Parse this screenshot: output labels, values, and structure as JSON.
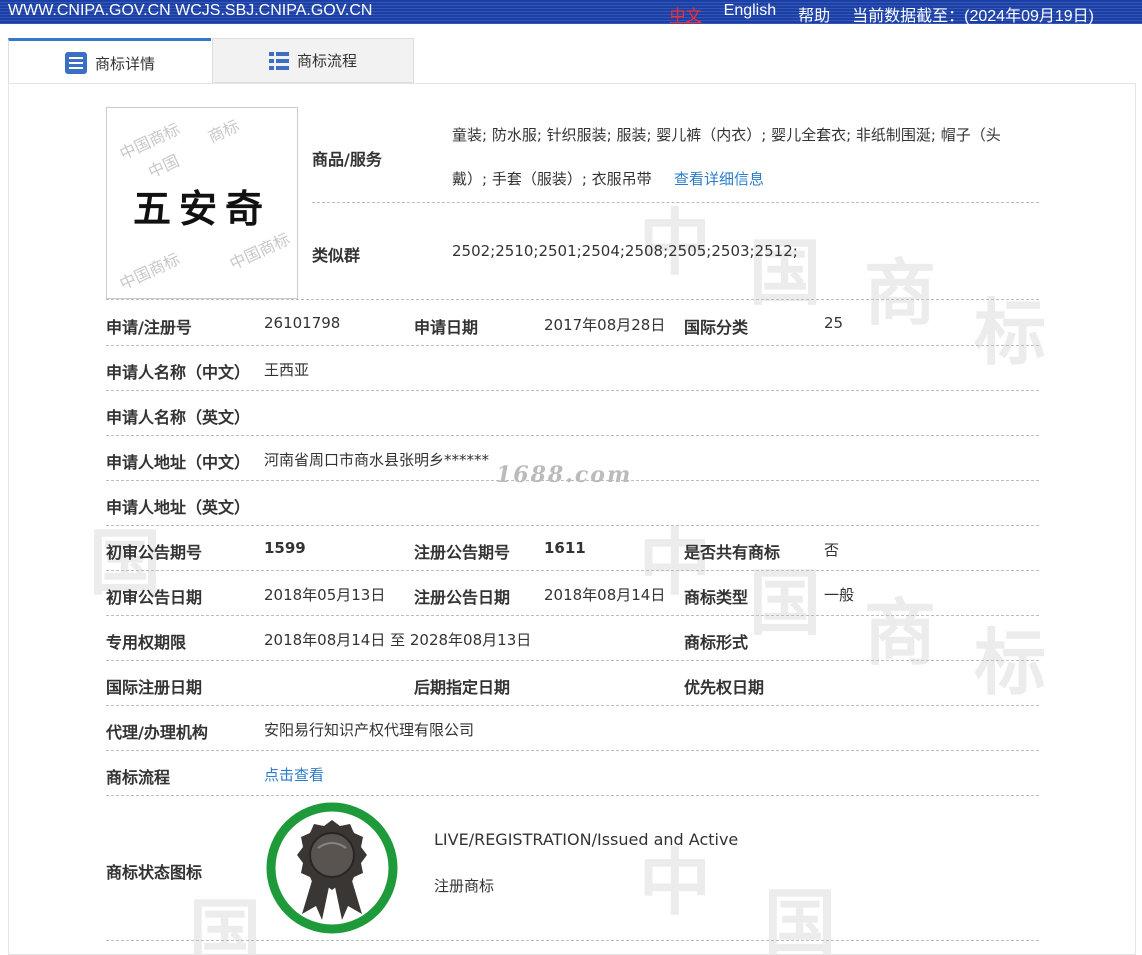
{
  "topbar": {
    "domains": "WWW.CNIPA.GOV.CN WCJS.SBJ.CNIPA.GOV.CN",
    "lang_zh": "中文",
    "lang_en": "English",
    "help": "帮助",
    "data_date": "当前数据截至：(2024年09月19日)"
  },
  "tabs": [
    {
      "label": "商标详情",
      "active": true
    },
    {
      "label": "商标流程",
      "active": false
    }
  ],
  "mark": {
    "logo_text": "五安奇",
    "goods_label": "商品/服务",
    "goods_value": "童装; 防水服; 针织服装; 服装; 婴儿裤（内衣）; 婴儿全套衣; 非纸制围涎; 帽子（头",
    "goods_value_2": "戴）; 手套（服装）; 衣服吊带",
    "goods_link": "查看详细信息",
    "similar_label": "类似群",
    "similar_value": "2502;2510;2501;2504;2508;2505;2503;2512;"
  },
  "fields": {
    "reg_no_label": "申请/注册号",
    "reg_no": "26101798",
    "apply_date_label": "申请日期",
    "apply_date": "2017年08月28日",
    "intl_class_label": "国际分类",
    "intl_class": "25",
    "applicant_cn_label": "申请人名称（中文）",
    "applicant_cn": "王西亚",
    "applicant_en_label": "申请人名称（英文）",
    "address_cn_label": "申请人地址（中文）",
    "address_cn": "河南省周口市商水县张明乡******",
    "address_en_label": "申请人地址（英文）",
    "prelim_no_label": "初审公告期号",
    "prelim_no": "1599",
    "reg_notice_no_label": "注册公告期号",
    "reg_notice_no": "1611",
    "shared_label": "是否共有商标",
    "shared": "否",
    "prelim_date_label": "初审公告日期",
    "prelim_date": "2018年05月13日",
    "reg_notice_date_label": "注册公告日期",
    "reg_notice_date": "2018年08月14日",
    "mark_type_label": "商标类型",
    "mark_type": "一般",
    "exclusive_label": "专用权期限",
    "exclusive": "2018年08月14日 至 2028年08月13日",
    "mark_form_label": "商标形式",
    "intl_reg_date_label": "国际注册日期",
    "later_date_label": "后期指定日期",
    "priority_label": "优先权日期",
    "agent_label": "代理/办理机构",
    "agent": "安阳易行知识产权代理有限公司",
    "flow_label": "商标流程",
    "flow_link": "点击查看",
    "status_label": "商标状态图标",
    "status_en": "LIVE/REGISTRATION/Issued and Active",
    "status_cn": "注册商标"
  },
  "watermark_text": "1688.com",
  "colors": {
    "topbar": "#1a3fa6",
    "link": "#2b7cc9",
    "badge_ring": "#1e9a3a"
  }
}
